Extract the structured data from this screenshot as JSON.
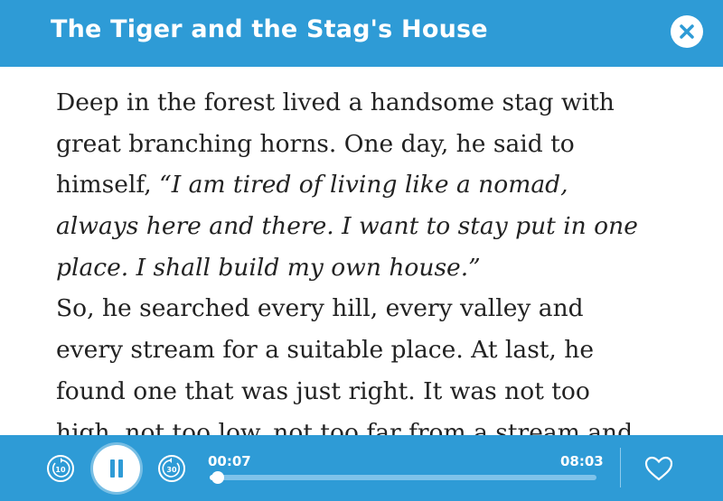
{
  "header": {
    "title": "The Tiger and the Stag's House",
    "close_icon": "close-icon"
  },
  "story": {
    "lines": [
      {
        "normal": "Deep in the forest lived a handsome stag with",
        "italic": ""
      },
      {
        "normal": "great branching horns. One day, he said to",
        "italic": ""
      },
      {
        "normal": "himself, ",
        "italic": "“I am tired of living like a nomad,"
      },
      {
        "normal": "",
        "italic": "always here and there. I want to stay put in one"
      },
      {
        "normal": "",
        "italic": "place. I shall build my own house.”"
      },
      {
        "normal": "So, he searched every hill, every valley and",
        "italic": ""
      },
      {
        "normal": "every stream for a suitable place. At last, he",
        "italic": ""
      },
      {
        "normal": "found one that was just right. It was not too",
        "italic": ""
      },
      {
        "normal": "high, not too low, not too far from a stream and",
        "italic": ""
      }
    ]
  },
  "player": {
    "current_time": "00:07",
    "total_time": "08:03",
    "progress": 0.0145,
    "skip_back_label": "10",
    "skip_forward_label": "30",
    "state": "playing",
    "accent_color": "#2e9bd6"
  }
}
